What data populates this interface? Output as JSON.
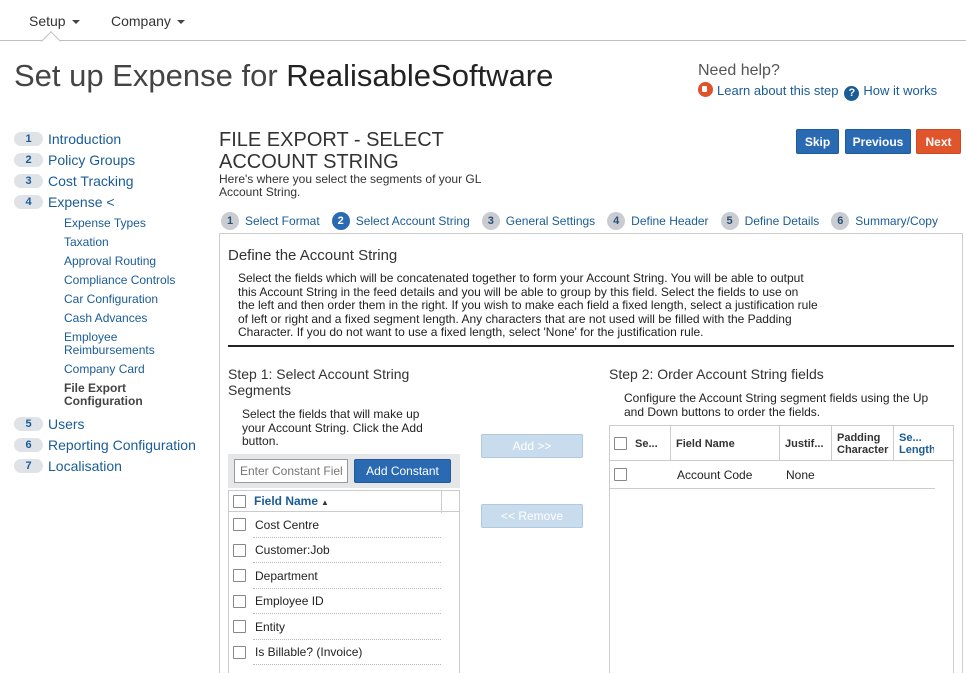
{
  "topnav": {
    "items": [
      {
        "label": "Setup"
      },
      {
        "label": "Company"
      }
    ]
  },
  "page": {
    "title_prefix": "Set up Expense for ",
    "company_name": "RealisableSoftware"
  },
  "help": {
    "need_help": "Need help?",
    "learn_link": "Learn about this step",
    "how_link": "How it works"
  },
  "sidebar": {
    "items": [
      {
        "num": "1",
        "label": "Introduction"
      },
      {
        "num": "2",
        "label": "Policy Groups"
      },
      {
        "num": "3",
        "label": "Cost Tracking"
      },
      {
        "num": "4",
        "label": "Expense <"
      },
      {
        "num": "5",
        "label": "Users"
      },
      {
        "num": "6",
        "label": "Reporting Configuration"
      },
      {
        "num": "7",
        "label": "Localisation"
      }
    ],
    "expense_sub": [
      "Expense Types",
      "Taxation",
      "Approval Routing",
      "Compliance Controls",
      "Car Configuration",
      "Cash Advances",
      "Employee Reimbursements",
      "Company Card",
      "File Export Configuration"
    ]
  },
  "main": {
    "heading": "FILE EXPORT - SELECT ACCOUNT STRING",
    "description": "Here's where you select the segments of your GL Account String.",
    "buttons": {
      "skip": "Skip",
      "previous": "Previous",
      "next": "Next"
    },
    "wizard": [
      {
        "num": "1",
        "label": "Select Format"
      },
      {
        "num": "2",
        "label": "Select Account String"
      },
      {
        "num": "3",
        "label": "General Settings"
      },
      {
        "num": "4",
        "label": "Define Header"
      },
      {
        "num": "5",
        "label": "Define Details"
      },
      {
        "num": "6",
        "label": "Summary/Copy"
      }
    ]
  },
  "panel": {
    "title": "Define the Account String",
    "description": "Select the fields which will be concatenated together to form your Account String. You will be able to output this Account String in the feed details and you will be able to group by this field. Select the fields to use on the left and then order them in the right. If you wish to make each field a fixed length, select a justification rule of left or right and a fixed segment length. Any characters that are not used will be filled with the Padding Character. If you do not want to use a fixed length, select 'None' for the justification rule.",
    "step1": {
      "title": "Step 1: Select Account String Segments",
      "description": "Select the fields that will make up your Account String. Click the Add button.",
      "constant_placeholder": "Enter Constant Field",
      "add_constant": "Add Constant",
      "column_header": "Field Name",
      "rows": [
        "Cost Centre",
        "Customer:Job",
        "Department",
        "Employee ID",
        "Entity",
        "Is Billable? (Invoice)"
      ]
    },
    "add_button": "Add >>",
    "remove_button": "<< Remove",
    "step2": {
      "title": "Step 2: Order Account String fields",
      "description": "Configure the Account String segment fields using the Up and Down buttons to order the fields.",
      "columns": [
        "Se...",
        "Field Name",
        "Justif...",
        "Padding Character",
        "Se... Length"
      ],
      "rows": [
        {
          "field_name": "Account Code",
          "justification": "None"
        }
      ]
    }
  }
}
